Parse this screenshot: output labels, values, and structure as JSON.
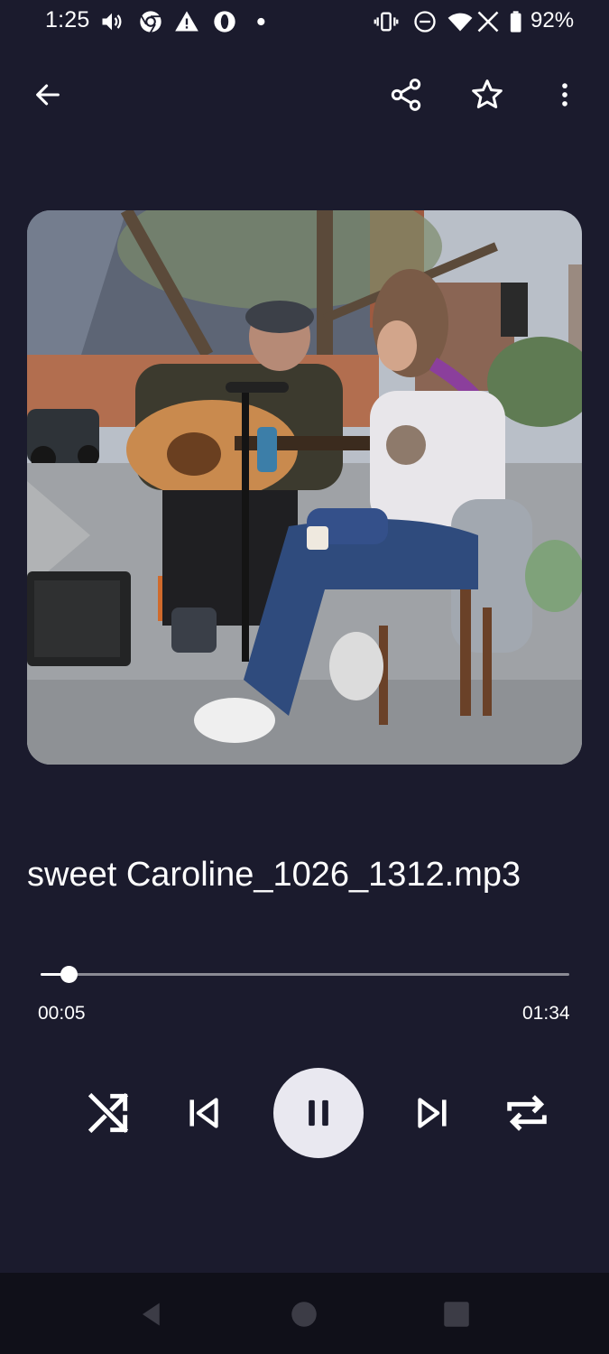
{
  "status_bar": {
    "time": "1:25",
    "battery_percent": "92%",
    "icons": [
      "volume-icon",
      "chrome-icon",
      "warning-icon",
      "opera-icon",
      "notification-dot-icon",
      "vibrate-icon",
      "do-not-disturb-icon",
      "wifi-icon",
      "no-signal-icon",
      "battery-icon"
    ]
  },
  "app_bar": {
    "icons": [
      "back-arrow-icon",
      "share-icon",
      "star-outline-icon",
      "more-vert-icon"
    ]
  },
  "player": {
    "track_title": "sweet Caroline_1026_1312.mp3",
    "elapsed": "00:05",
    "duration": "01:34",
    "progress_fraction": 0.053,
    "is_playing": true,
    "controls": [
      "shuffle-icon",
      "skip-previous-icon",
      "pause-icon",
      "skip-next-icon",
      "repeat-icon"
    ]
  },
  "nav_bar": {
    "buttons": [
      "back-triangle-icon",
      "home-circle-icon",
      "recents-square-icon"
    ]
  },
  "colors": {
    "background": "#1b1b2d",
    "accent": "#ffffff",
    "play_button": "#e9e8f0",
    "nav_bar": "#101019"
  }
}
